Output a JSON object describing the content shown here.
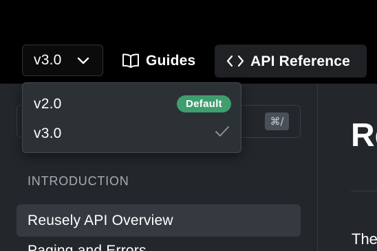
{
  "topnav": {
    "version_selector": {
      "label": "v3.0",
      "icon": "chevron-down-icon"
    },
    "guides": {
      "label": "Guides",
      "icon": "book-icon"
    },
    "api_reference": {
      "label": "API Reference",
      "icon": "code-icon"
    }
  },
  "version_menu": {
    "options": [
      {
        "label": "v2.0",
        "badge": "Default",
        "selected": false
      },
      {
        "label": "v3.0",
        "badge": "",
        "selected": true,
        "icon": "checkmark-icon"
      }
    ]
  },
  "sidebar": {
    "search": {
      "shortcut": "⌘/"
    },
    "section_title": "INTRODUCTION",
    "items": [
      {
        "label": "Reusely API Overview",
        "active": true
      },
      {
        "label": "Paging and Errors",
        "active": false
      }
    ]
  },
  "main": {
    "heading": "Re",
    "text": "The"
  },
  "colors": {
    "background": "#000000",
    "sidebar": "#23272b",
    "dropdown": "#2c3136",
    "badge": "#3f9e6e",
    "active_item": "#343a40"
  }
}
